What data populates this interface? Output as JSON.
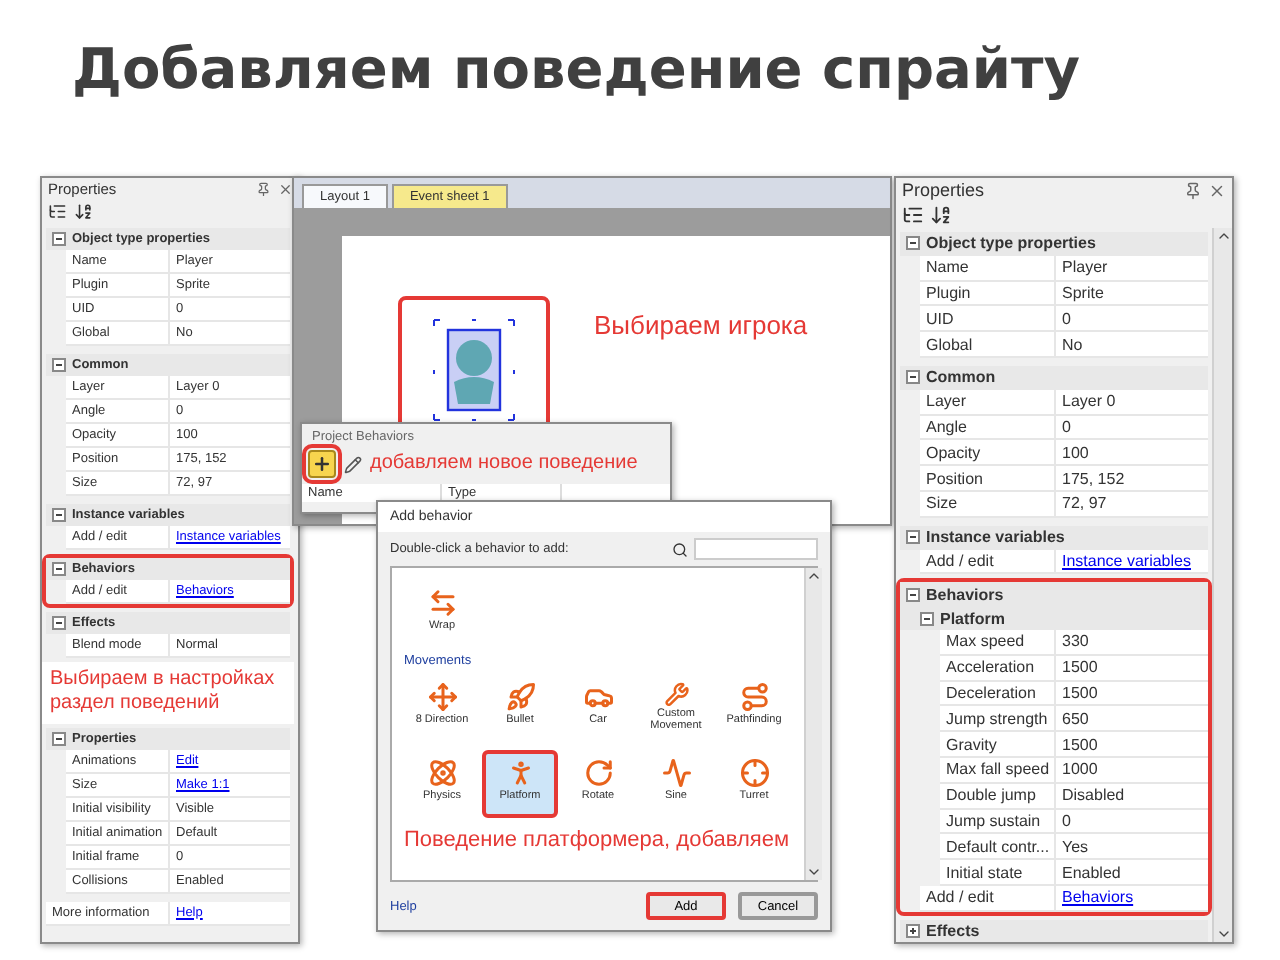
{
  "title": "Добавляем поведение спрайту",
  "left_panel": {
    "title": "Properties",
    "groups": [
      {
        "label": "Object type properties",
        "expanded": true,
        "highlighted": false,
        "rows": [
          {
            "kind": "text",
            "name": "Name",
            "value": "Player"
          },
          {
            "kind": "text",
            "name": "Plugin",
            "value": "Sprite"
          },
          {
            "kind": "text",
            "name": "UID",
            "value": "0"
          },
          {
            "kind": "text",
            "name": "Global",
            "value": "No"
          }
        ]
      },
      {
        "label": "Common",
        "expanded": true,
        "highlighted": false,
        "rows": [
          {
            "kind": "text",
            "name": "Layer",
            "value": "Layer 0"
          },
          {
            "kind": "text",
            "name": "Angle",
            "value": "0"
          },
          {
            "kind": "text",
            "name": "Opacity",
            "value": "100"
          },
          {
            "kind": "text",
            "name": "Position",
            "value": "175, 152"
          },
          {
            "kind": "text",
            "name": "Size",
            "value": "72, 97"
          }
        ]
      },
      {
        "label": "Instance variables",
        "expanded": true,
        "highlighted": false,
        "rows": [
          {
            "kind": "link",
            "name": "Add / edit",
            "value": "Instance variables"
          }
        ]
      },
      {
        "label": "Behaviors",
        "expanded": true,
        "highlighted": true,
        "rows": [
          {
            "kind": "link",
            "name": "Add / edit",
            "value": "Behaviors"
          }
        ]
      },
      {
        "label": "Effects",
        "expanded": true,
        "highlighted": false,
        "rows": [
          {
            "kind": "text",
            "name": "Blend mode",
            "value": "Normal"
          }
        ]
      }
    ],
    "annotation": "Выбираем в настройках раздел поведений",
    "groups_below": [
      {
        "label": "Properties",
        "expanded": true,
        "highlighted": false,
        "rows": [
          {
            "kind": "link",
            "name": "Animations",
            "value": "Edit"
          },
          {
            "kind": "link",
            "name": "Size",
            "value": "Make 1:1"
          },
          {
            "kind": "text",
            "name": "Initial visibility",
            "value": "Visible"
          },
          {
            "kind": "text",
            "name": "Initial animation",
            "value": "Default"
          },
          {
            "kind": "text",
            "name": "Initial frame",
            "value": "0"
          },
          {
            "kind": "text",
            "name": "Collisions",
            "value": "Enabled"
          }
        ]
      }
    ],
    "footer": {
      "kind": "link",
      "name": "More information",
      "value": "Help"
    }
  },
  "layout_view": {
    "tabs": [
      {
        "label": "Layout 1",
        "selected": true
      },
      {
        "label": "Event sheet 1",
        "selected": false
      }
    ],
    "sprite_highlighted": true,
    "annotation": "Выбираем игрока"
  },
  "project_behaviors": {
    "title": "Project Behaviors",
    "add_highlighted": true,
    "annotation": "добавляем новое поведение",
    "columns": [
      "Name",
      "Type"
    ]
  },
  "add_behavior": {
    "title": "Add behavior",
    "prompt": "Double-click a behavior to add:",
    "sections": [
      {
        "items": [
          {
            "label": "Wrap",
            "selected": false
          }
        ]
      },
      {
        "title": "Movements",
        "items": [
          {
            "label": "8 Direction",
            "selected": false
          },
          {
            "label": "Bullet",
            "selected": false
          },
          {
            "label": "Car",
            "selected": false
          },
          {
            "label": "Custom Movement",
            "selected": false
          },
          {
            "label": "Pathfinding",
            "selected": false
          },
          {
            "label": "Physics",
            "selected": false
          },
          {
            "label": "Platform",
            "selected": true
          },
          {
            "label": "Rotate",
            "selected": false
          },
          {
            "label": "Sine",
            "selected": false
          },
          {
            "label": "Turret",
            "selected": false
          }
        ]
      }
    ],
    "annotation": "Поведение платформера, добавляем",
    "help": "Help",
    "buttons": [
      {
        "label": "Add",
        "highlighted": true
      },
      {
        "label": "Cancel",
        "highlighted": false
      }
    ]
  },
  "right_panel": {
    "title": "Properties",
    "groups": [
      {
        "label": "Object type properties",
        "expanded": true,
        "highlighted": false,
        "rows": [
          {
            "kind": "text",
            "name": "Name",
            "value": "Player"
          },
          {
            "kind": "text",
            "name": "Plugin",
            "value": "Sprite"
          },
          {
            "kind": "text",
            "name": "UID",
            "value": "0"
          },
          {
            "kind": "text",
            "name": "Global",
            "value": "No"
          }
        ]
      },
      {
        "label": "Common",
        "expanded": true,
        "highlighted": false,
        "rows": [
          {
            "kind": "text",
            "name": "Layer",
            "value": "Layer 0"
          },
          {
            "kind": "text",
            "name": "Angle",
            "value": "0"
          },
          {
            "kind": "text",
            "name": "Opacity",
            "value": "100"
          },
          {
            "kind": "text",
            "name": "Position",
            "value": "175, 152"
          },
          {
            "kind": "text",
            "name": "Size",
            "value": "72, 97"
          }
        ]
      },
      {
        "label": "Instance variables",
        "expanded": true,
        "highlighted": false,
        "rows": [
          {
            "kind": "link",
            "name": "Add / edit",
            "value": "Instance variables"
          }
        ]
      },
      {
        "label": "Behaviors",
        "expanded": true,
        "highlighted": true,
        "rows": [
          {
            "kind": "subgroup",
            "label": "Platform",
            "expanded": true,
            "rows": [
              {
                "kind": "text",
                "name": "Max speed",
                "value": "330"
              },
              {
                "kind": "text",
                "name": "Acceleration",
                "value": "1500"
              },
              {
                "kind": "text",
                "name": "Deceleration",
                "value": "1500"
              },
              {
                "kind": "text",
                "name": "Jump strength",
                "value": "650"
              },
              {
                "kind": "text",
                "name": "Gravity",
                "value": "1500"
              },
              {
                "kind": "text",
                "name": "Max fall speed",
                "value": "1000"
              },
              {
                "kind": "text",
                "name": "Double jump",
                "value": "Disabled"
              },
              {
                "kind": "text",
                "name": "Jump sustain",
                "value": "0"
              },
              {
                "kind": "text",
                "name": "Default contr...",
                "value": "Yes"
              },
              {
                "kind": "text",
                "name": "Initial state",
                "value": "Enabled"
              }
            ]
          },
          {
            "kind": "link",
            "name": "Add / edit",
            "value": "Behaviors"
          }
        ]
      },
      {
        "label": "Effects",
        "expanded": false,
        "highlighted": false
      }
    ]
  }
}
